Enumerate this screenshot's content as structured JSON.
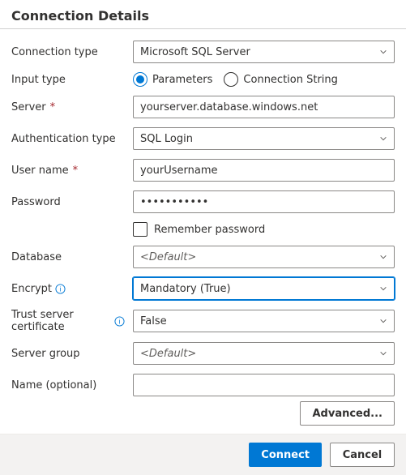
{
  "header": {
    "title": "Connection Details"
  },
  "labels": {
    "connection_type": "Connection type",
    "input_type": "Input type",
    "server": "Server",
    "auth_type": "Authentication type",
    "username": "User name",
    "password": "Password",
    "remember": "Remember password",
    "database": "Database",
    "encrypt": "Encrypt",
    "trust_cert": "Trust server certificate",
    "server_group": "Server group",
    "name_optional": "Name (optional)"
  },
  "values": {
    "connection_type": "Microsoft SQL Server",
    "input_type_parameters": "Parameters",
    "input_type_connstr": "Connection String",
    "input_type_selected": "Parameters",
    "server": "yourserver.database.windows.net",
    "auth_type": "SQL Login",
    "username": "yourUsername",
    "password": "•••••••••••",
    "remember_checked": false,
    "database": "<Default>",
    "encrypt": "Mandatory (True)",
    "trust_cert": "False",
    "server_group": "<Default>",
    "name_optional": ""
  },
  "buttons": {
    "advanced": "Advanced...",
    "connect": "Connect",
    "cancel": "Cancel"
  }
}
